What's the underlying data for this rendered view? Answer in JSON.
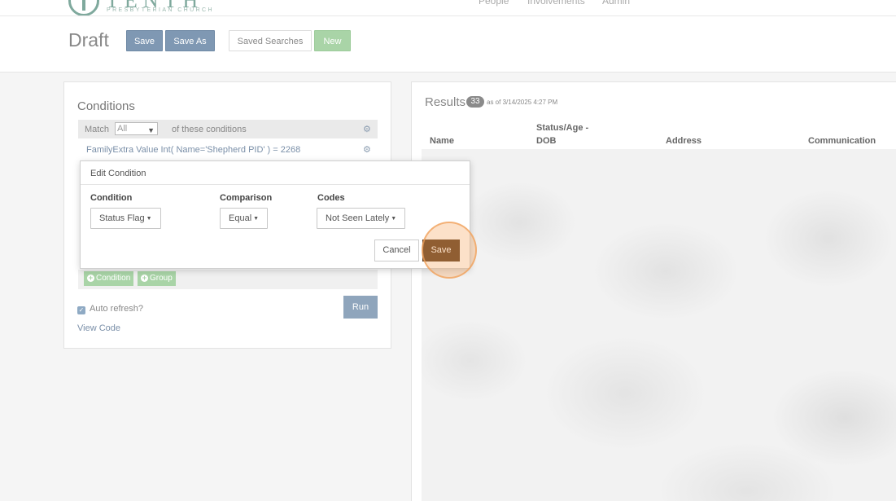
{
  "nav": {
    "logo_text": "TENTH",
    "logo_sub": "PRESBYTERIAN CHURCH",
    "links": [
      "People",
      "Involvements",
      "Admin"
    ]
  },
  "header": {
    "title": "Draft",
    "save": "Save",
    "save_as": "Save As",
    "saved_searches": "Saved Searches",
    "new": "New"
  },
  "conditions": {
    "title": "Conditions",
    "match_label": "Match",
    "match_value": "All",
    "match_suffix": "of these conditions",
    "condition_text": "FamilyExtra Value Int( Name='Shepherd PID' ) = 2268",
    "add_condition": "Condition",
    "add_group": "Group",
    "auto_refresh": "Auto refresh?",
    "run": "Run",
    "view_code": "View Code"
  },
  "edit_condition": {
    "title": "Edit Condition",
    "condition_label": "Condition",
    "condition_value": "Status Flag",
    "comparison_label": "Comparison",
    "comparison_value": "Equal",
    "codes_label": "Codes",
    "codes_value": "Not Seen Lately",
    "cancel": "Cancel",
    "save": "Save"
  },
  "results": {
    "title": "Results",
    "count": "33",
    "as_of": "as of 3/14/2025 4:27 PM",
    "columns": [
      "Name",
      "Status/Age - DOB",
      "Address",
      "Communication"
    ]
  },
  "colors": {
    "accent_blue": "#7f98b3",
    "new_green": "#a9d4a7",
    "save_brown": "#5a3718",
    "click_highlight": "#f6aa64"
  }
}
